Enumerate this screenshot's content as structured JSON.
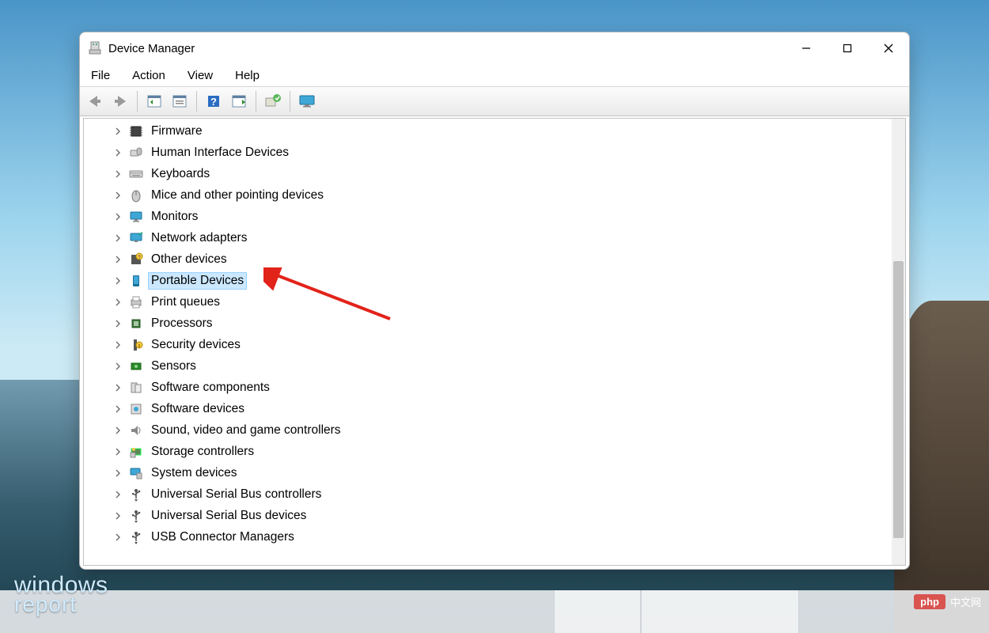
{
  "window": {
    "title": "Device Manager"
  },
  "menubar": [
    "File",
    "Action",
    "View",
    "Help"
  ],
  "toolbar_buttons": [
    "back",
    "forward",
    "show-hidden",
    "properties",
    "help",
    "scan",
    "update-driver",
    "monitor"
  ],
  "tree": {
    "selected": "Portable Devices",
    "nodes": [
      {
        "label": "Firmware",
        "icon": "chip"
      },
      {
        "label": "Human Interface Devices",
        "icon": "hid"
      },
      {
        "label": "Keyboards",
        "icon": "keyboard"
      },
      {
        "label": "Mice and other pointing devices",
        "icon": "mouse"
      },
      {
        "label": "Monitors",
        "icon": "monitor"
      },
      {
        "label": "Network adapters",
        "icon": "network"
      },
      {
        "label": "Other devices",
        "icon": "unknown"
      },
      {
        "label": "Portable Devices",
        "icon": "portable"
      },
      {
        "label": "Print queues",
        "icon": "printer"
      },
      {
        "label": "Processors",
        "icon": "cpu"
      },
      {
        "label": "Security devices",
        "icon": "security"
      },
      {
        "label": "Sensors",
        "icon": "sensor"
      },
      {
        "label": "Software components",
        "icon": "swcomp"
      },
      {
        "label": "Software devices",
        "icon": "swdev"
      },
      {
        "label": "Sound, video and game controllers",
        "icon": "sound"
      },
      {
        "label": "Storage controllers",
        "icon": "storage"
      },
      {
        "label": "System devices",
        "icon": "system"
      },
      {
        "label": "Universal Serial Bus controllers",
        "icon": "usb"
      },
      {
        "label": "Universal Serial Bus devices",
        "icon": "usb"
      },
      {
        "label": "USB Connector Managers",
        "icon": "usb"
      }
    ]
  },
  "watermarks": {
    "wr_line1": "windows",
    "wr_line2": "report",
    "php_badge": "php",
    "php_text": "中文网"
  }
}
